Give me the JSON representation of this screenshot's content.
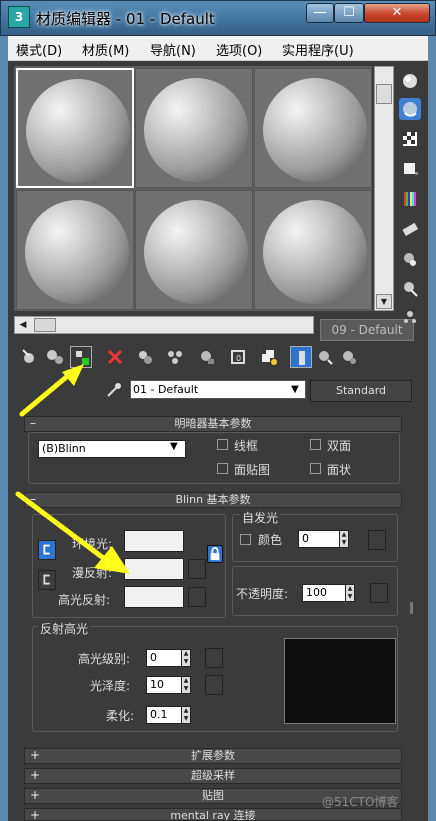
{
  "window": {
    "logo_text": "3",
    "title": "材质编辑器 - 01 - Default",
    "min_label": "—",
    "max_label": "☐",
    "close_label": "✕"
  },
  "menu": [
    "模式(D)",
    "材质(M)",
    "导航(N)",
    "选项(O)",
    "实用程序(U)"
  ],
  "slots": {
    "tooltip": "09 - Default"
  },
  "material": {
    "name": "01 - Default",
    "type": "Standard"
  },
  "shader_rollout": {
    "title": "明暗器基本参数",
    "sign": "–",
    "shader": "(B)Blinn",
    "options": [
      "线框",
      "双面",
      "面贴图",
      "面状"
    ]
  },
  "blinn_rollout": {
    "title": "Blinn 基本参数",
    "sign": "–",
    "self_illum": {
      "group_label": "自发光",
      "color_label": "颜色",
      "value": "0"
    },
    "ambient_label": "环境光:",
    "diffuse_label": "漫反射:",
    "specular_label": "高光反射:",
    "opacity_label": "不透明度:",
    "opacity_value": "100",
    "specular_highlights": {
      "group_label": "反射高光",
      "level_label": "高光级别:",
      "level_value": "0",
      "gloss_label": "光泽度:",
      "gloss_value": "10",
      "soften_label": "柔化:",
      "soften_value": "0.1"
    }
  },
  "collapsed_rollouts": [
    {
      "sign": "+",
      "title": "扩展参数"
    },
    {
      "sign": "+",
      "title": "超级采样"
    },
    {
      "sign": "+",
      "title": "贴图"
    },
    {
      "sign": "+",
      "title": "mental ray 连接"
    }
  ],
  "watermark": "@51CTO博客",
  "colors": {
    "annotation_arrow": "#ffff1a",
    "active_blue": "#2d74d0"
  }
}
